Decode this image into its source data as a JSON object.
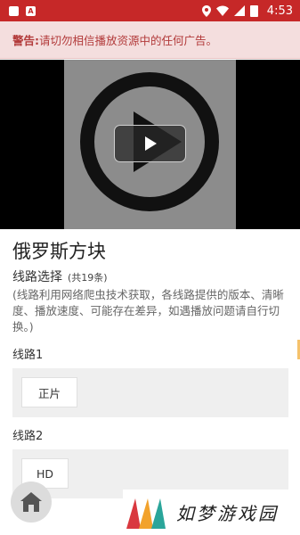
{
  "status_bar": {
    "time": "4:53",
    "icon_a": "A",
    "battery_label": ""
  },
  "warning": {
    "prefix": "警告:",
    "message": "请切勿相信播放资源中的任何广告。"
  },
  "video": {
    "play_icon": "play-icon"
  },
  "page": {
    "title": "俄罗斯方块",
    "route_select_label": "线路选择",
    "route_count": "(共19条)",
    "note": "(线路利用网络爬虫技术获取，各线路提供的版本、清晰度、播放速度、可能存在差异，如遇播放问题请自行切换。)"
  },
  "routes": [
    {
      "label": "线路1",
      "episode": "正片"
    },
    {
      "label": "线路2",
      "episode": "HD"
    }
  ],
  "watermark": {
    "text": "如梦游戏园"
  },
  "colors": {
    "status_bar": "#c62828",
    "warning_bg": "#f4dede",
    "warning_text": "#b23a3a"
  }
}
